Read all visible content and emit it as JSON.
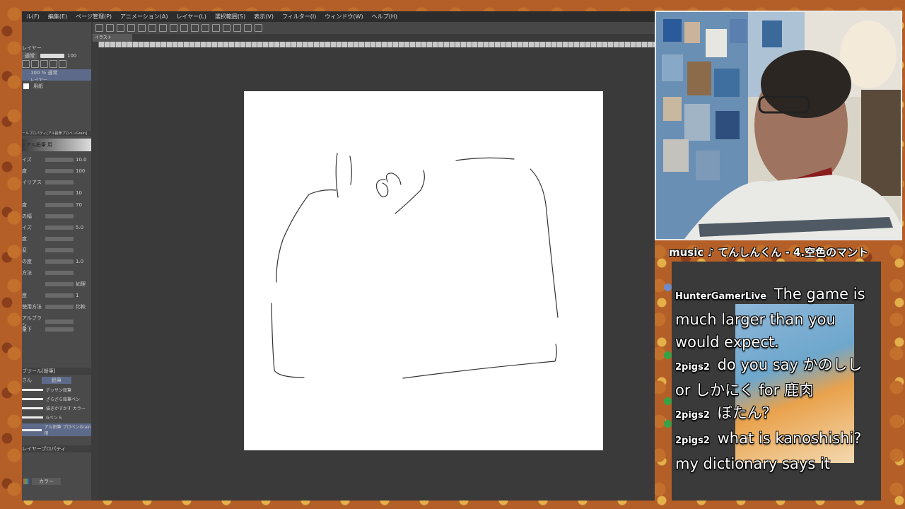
{
  "menu": [
    "ル(F)",
    "編集(E)",
    "ページ管理(P)",
    "アニメーション(A)",
    "レイヤー(L)",
    "選択範囲(S)",
    "表示(V)",
    "フィルター(I)",
    "ウィンドウ(W)",
    "ヘルプ(H)"
  ],
  "tab": {
    "label": "イラスト"
  },
  "layers": {
    "title": "レイヤー",
    "blend": "通常",
    "opacity": "100",
    "layer1": "100 % 通常",
    "layer1_sub": "レイヤー",
    "paper": "用紙"
  },
  "tool_property": {
    "title": "ールプロパティ[アル鉛筆プロペンGrain]",
    "brush_name": "アル鉛筆 用",
    "rows": [
      {
        "label": "イズ",
        "value": "10.0"
      },
      {
        "label": "度",
        "value": "100"
      },
      {
        "label": "イリアス",
        "value": ""
      },
      {
        "label": "",
        "value": "10"
      },
      {
        "label": "度",
        "value": "70"
      },
      {
        "label": "の幅",
        "value": ""
      },
      {
        "label": "イズ",
        "value": "5.0"
      },
      {
        "label": "度",
        "value": ""
      },
      {
        "label": "変",
        "value": ""
      },
      {
        "label": "の度",
        "value": "1.0"
      },
      {
        "label": "方法",
        "value": ""
      },
      {
        "label": "",
        "value": "如理"
      },
      {
        "label": "度",
        "value": "1"
      },
      {
        "label": "使用方法",
        "value": "比較"
      },
      {
        "label": "アルブラシ",
        "value": ""
      },
      {
        "label": "量下",
        "value": ""
      }
    ]
  },
  "subtool": {
    "title": "ブツール[鉛筆]",
    "tab1": "さん",
    "tab2": "鉛筆",
    "brushes": [
      "デッサン鉛筆",
      "ざらざら鉛筆ペン",
      "描きかすかす カラー",
      "Gペン 5",
      "アル鉛筆 プロペンGrain用"
    ]
  },
  "color": {
    "title": "レイヤープロパティ",
    "mode": "カラー"
  },
  "music": "music ♪ てんしんくん - 4.空色のマント",
  "chat": [
    {
      "user": "HunterGamerLive",
      "text": "The game is much larger than you would expect."
    },
    {
      "user": "2pigs2",
      "text": "do you say かのしし or しかにく for 鹿肉"
    },
    {
      "user": "2pigs2",
      "text": "ぼたん？"
    },
    {
      "user": "2pigs2",
      "text": "what is kanoshishi? my dictionary says it"
    }
  ],
  "colors": {
    "accent": "#5d6a8a",
    "canvas": "#ffffff",
    "workspace": "#3a3a3a",
    "badge": "#35a447"
  }
}
